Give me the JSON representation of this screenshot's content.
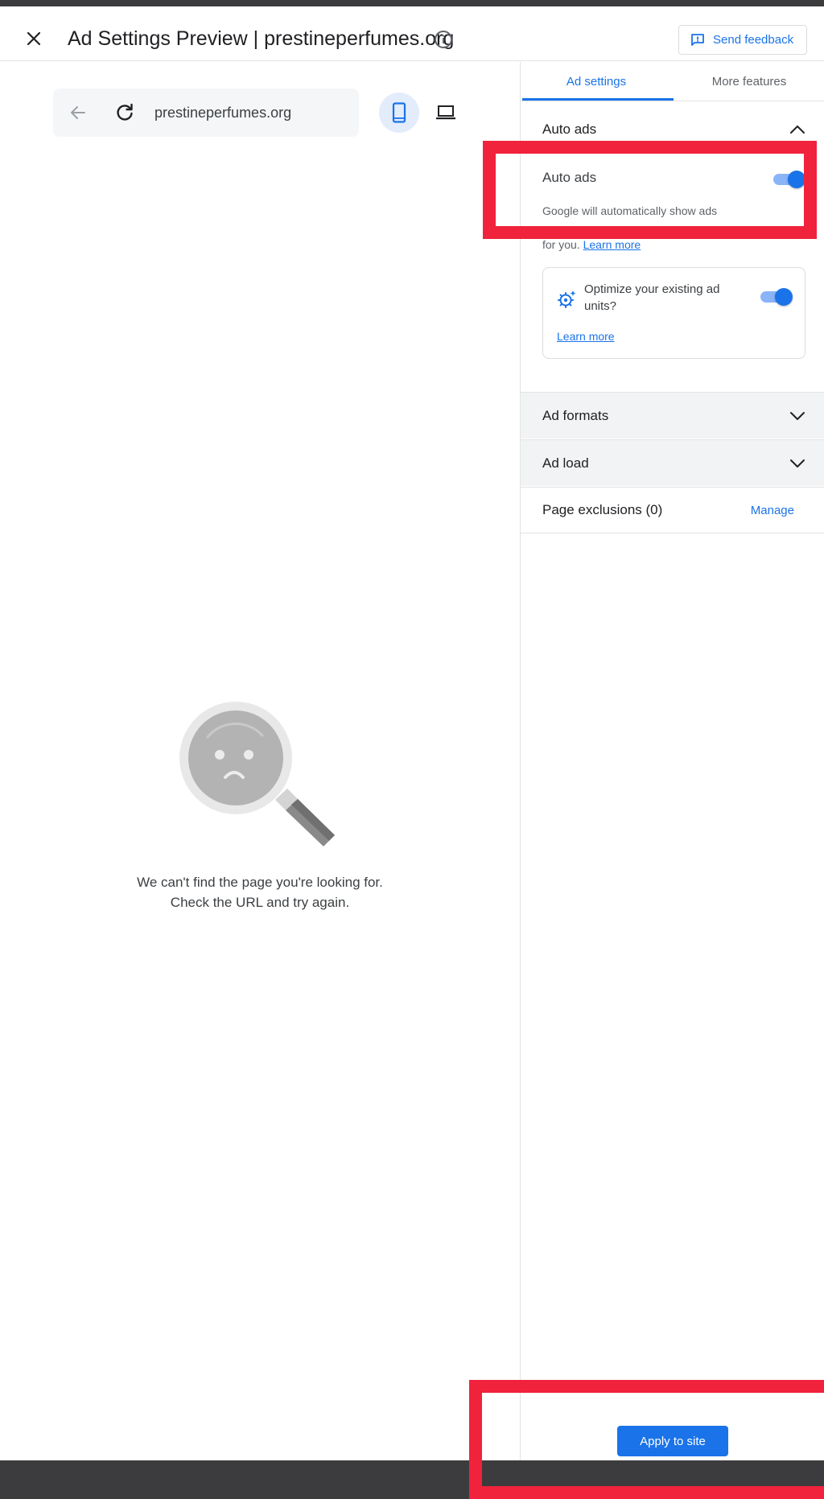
{
  "header": {
    "title": "Ad Settings Preview | prestineperfumes.org",
    "feedback_label": "Send feedback"
  },
  "preview": {
    "url": "prestineperfumes.org",
    "error_line1": "We can't find the page you're looking for.",
    "error_line2": "Check the URL and try again."
  },
  "panel": {
    "tabs": [
      {
        "label": "Ad settings",
        "active": true
      },
      {
        "label": "More features",
        "active": false
      }
    ],
    "auto_ads_section": {
      "title": "Auto ads",
      "toggle_label": "Auto ads",
      "toggle_on": true,
      "description": "Google will automatically show ads",
      "description_end": "for you.",
      "learn_more": "Learn more"
    },
    "optimize_card": {
      "text": "Optimize your existing ad units?",
      "toggle_on": true,
      "learn_more": "Learn more"
    },
    "ad_formats": "Ad formats",
    "ad_load": "Ad load",
    "page_exclusions": "Page exclusions (0)",
    "manage": "Manage"
  },
  "footer": {
    "apply_label": "Apply to site"
  },
  "colors": {
    "accent": "#1a73e8",
    "annotation_red": "#f0223c"
  }
}
